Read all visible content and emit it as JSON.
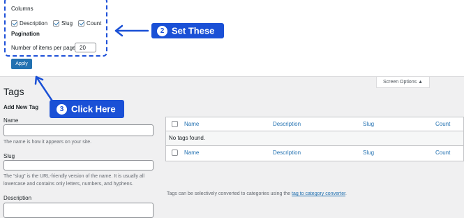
{
  "screen_options": {
    "columns_heading": "Columns",
    "columns": [
      {
        "label": "Description",
        "checked": true
      },
      {
        "label": "Slug",
        "checked": true
      },
      {
        "label": "Count",
        "checked": true
      }
    ],
    "pagination_heading": "Pagination",
    "items_per_page_label": "Number of items per page:",
    "items_per_page_value": "20",
    "apply_label": "Apply",
    "tab_label": "Screen Options ▲"
  },
  "callouts": {
    "set_these": {
      "number": "2",
      "text": "Set These"
    },
    "click_here": {
      "number": "3",
      "text": "Click Here"
    },
    "color": "#1a50d6"
  },
  "page": {
    "title": "Tags",
    "add_new_heading": "Add New Tag",
    "name_label": "Name",
    "name_help": "The name is how it appears on your site.",
    "slug_label": "Slug",
    "slug_help_1": "The “slug” is the URL-friendly version of the name. It is usually all",
    "slug_help_2": "lowercase and contains only letters, numbers, and hyphens.",
    "description_label": "Description"
  },
  "table": {
    "columns": [
      "Name",
      "Description",
      "Slug",
      "Count"
    ],
    "empty_message": "No tags found."
  },
  "footer_note": {
    "prefix": "Tags can be selectively converted to categories using the ",
    "link": "tag to category converter",
    "suffix": "."
  }
}
